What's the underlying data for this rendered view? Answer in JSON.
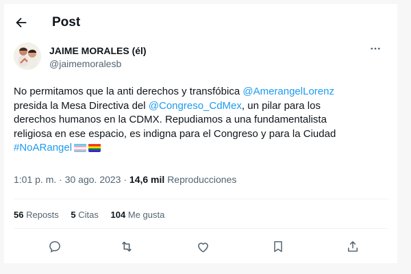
{
  "header": {
    "title": "Post"
  },
  "author": {
    "name": "JAIME MORALES (él)",
    "handle": "@jaimemoralesb"
  },
  "tweet": {
    "lines": [
      [
        {
          "t": "No permitamos que la anti derechos y transfóbica "
        },
        {
          "t": "@AmerangelLorenz",
          "link": true
        }
      ],
      [
        {
          "t": "presida la Mesa Directiva del "
        },
        {
          "t": "@Congreso_CdMex",
          "link": true
        },
        {
          "t": ", un pilar para los"
        }
      ],
      [
        {
          "t": "derechos humanos en la CDMX. Repudiamos a una fundamentalista"
        }
      ],
      [
        {
          "t": "religiosa en ese espacio, es indigna para el Congreso y para la Ciudad"
        }
      ],
      [
        {
          "t": "#NoARangel",
          "link": true
        }
      ]
    ],
    "emojis": [
      "transgender-flag-icon",
      "rainbow-flag-icon"
    ]
  },
  "meta": {
    "time": "1:01 p. m.",
    "separator": " · ",
    "date": "30 ago. 2023",
    "views_count": "14,6 mil",
    "views_label": "Reproducciones"
  },
  "stats": {
    "reposts_count": "56",
    "reposts_label": "Reposts",
    "quotes_count": "5",
    "quotes_label": "Citas",
    "likes_count": "104",
    "likes_label": "Me gusta"
  },
  "actions": [
    "reply-icon",
    "repost-icon",
    "like-icon",
    "bookmark-icon",
    "share-icon"
  ],
  "colors": {
    "link": "#1d9bf0",
    "secondary_text": "#536471",
    "icon": "#536471"
  }
}
